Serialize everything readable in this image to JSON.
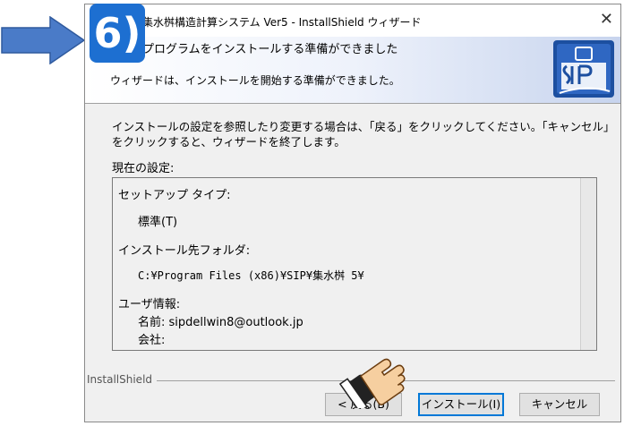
{
  "step_badge": "6)",
  "window": {
    "title": "集水桝構造計算システム Ver5 - InstallShield ウィザード",
    "close_icon": "close-icon"
  },
  "header": {
    "heading": "プログラムをインストールする準備ができました",
    "subheading": "ウィザードは、インストールを開始する準備ができました。"
  },
  "body": {
    "description": "インストールの設定を参照したり変更する場合は、「戻る」をクリックしてください。「キャンセル」をクリックすると、ウィザードを終了します。",
    "current_settings_label": "現在の設定:",
    "setup_type_label": "セットアップ タイプ:",
    "setup_type_value": "標準(T)",
    "install_folder_label": "インストール先フォルダ:",
    "install_folder_value": "C:¥Program Files (x86)¥SIP¥集水桝 5¥",
    "user_info_label": "ユーザ情報:",
    "name_line": "名前:  sipdellwin8@outlook.jp",
    "company_line": "会社:"
  },
  "footer": {
    "installshield_label": "InstallShield",
    "back_button": "< 戻る(B)",
    "install_button": "インストール(I)",
    "cancel_button": "キャンセル"
  },
  "colors": {
    "arrow": "#4a7bc8",
    "badge": "#1d6fd1",
    "default_button_border": "#0078d7"
  }
}
